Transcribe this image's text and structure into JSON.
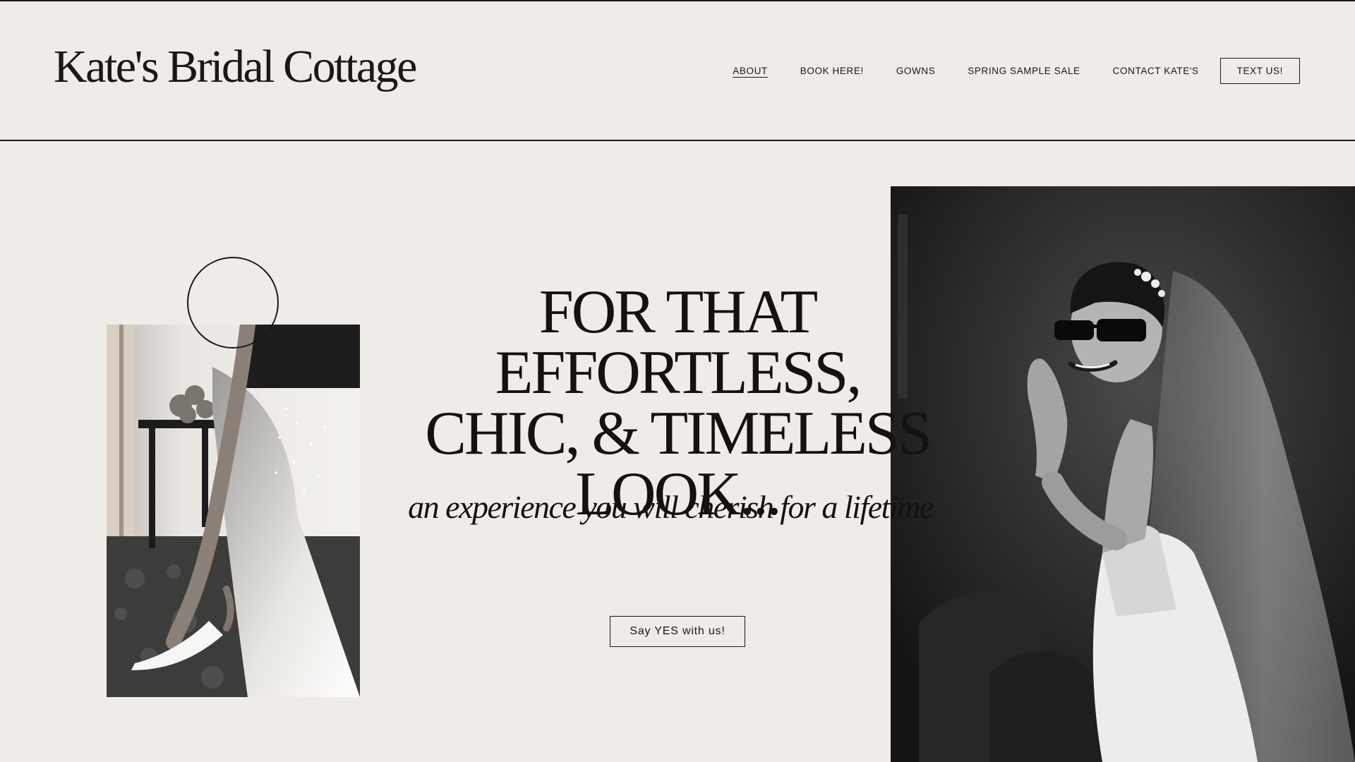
{
  "header": {
    "logo": "Kate's Bridal Cottage",
    "nav": [
      {
        "label": "ABOUT",
        "active": true
      },
      {
        "label": "BOOK HERE!",
        "active": false
      },
      {
        "label": "GOWNS",
        "active": false
      },
      {
        "label": "SPRING SAMPLE SALE",
        "active": false
      },
      {
        "label": "CONTACT KATE'S",
        "active": false
      }
    ],
    "cta_label": "TEXT US!"
  },
  "hero": {
    "headline_lines": [
      "FOR THAT EFFORTLESS,",
      "CHIC, & TIMELESS",
      "LOOK..."
    ],
    "tagline": "an experience you will cherish for a lifetime",
    "button_label": "Say YES with us!"
  },
  "colors": {
    "background": "#efebe6",
    "ink": "#1a1816"
  }
}
